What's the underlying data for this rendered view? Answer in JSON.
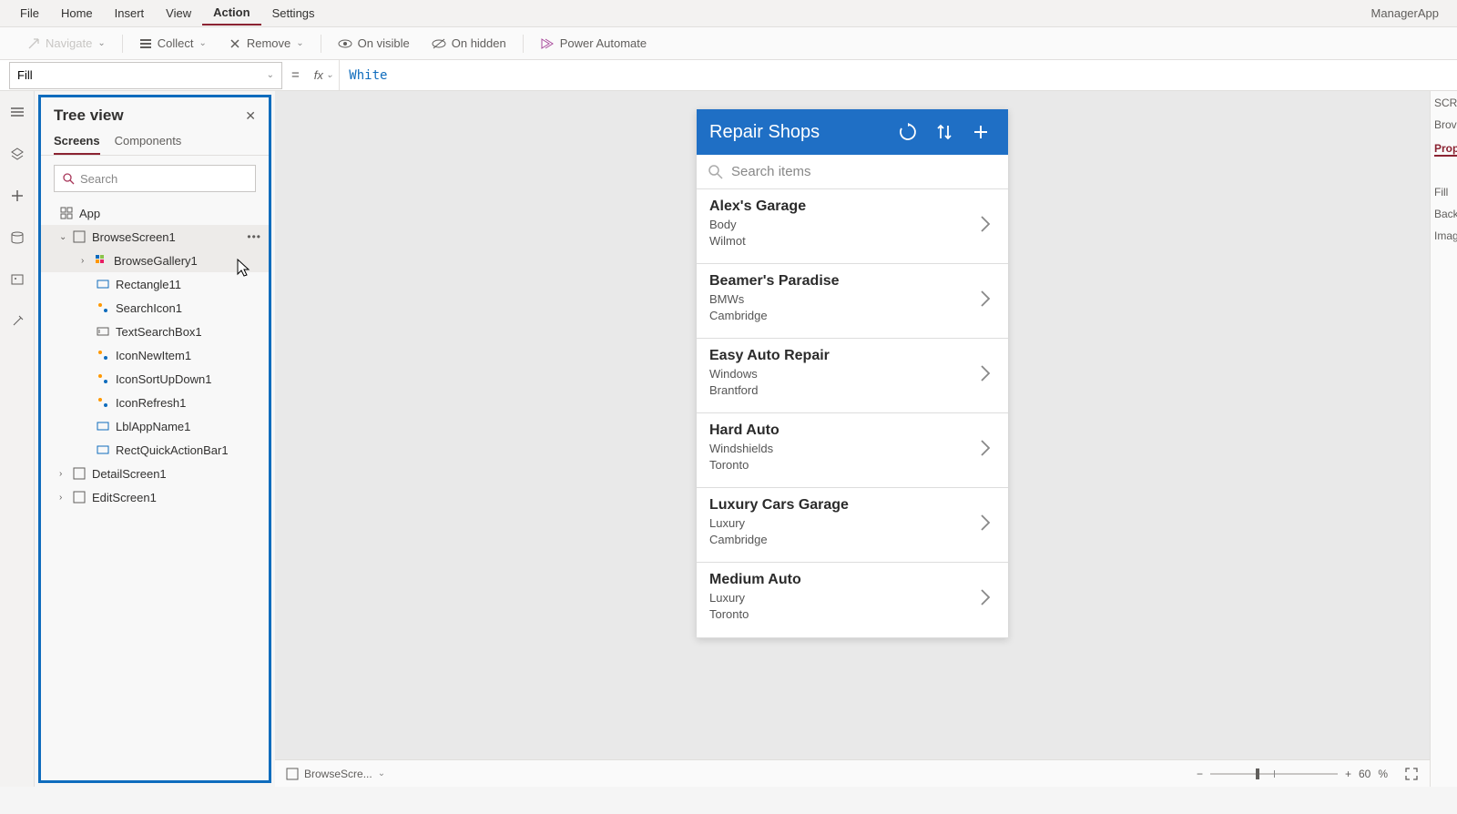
{
  "app_name": "ManagerApp",
  "menubar": {
    "items": [
      "File",
      "Home",
      "Insert",
      "View",
      "Action",
      "Settings"
    ],
    "active_index": 4
  },
  "ribbon": {
    "navigate": "Navigate",
    "collect": "Collect",
    "remove": "Remove",
    "onvisible": "On visible",
    "onhidden": "On hidden",
    "powerautomate": "Power Automate"
  },
  "formulabar": {
    "property": "Fill",
    "formula": "White"
  },
  "treeview": {
    "title": "Tree view",
    "tabs": [
      "Screens",
      "Components"
    ],
    "active_tab": 0,
    "search_placeholder": "Search",
    "items": {
      "app": "App",
      "browsescreen": "BrowseScreen1",
      "browsegallery": "BrowseGallery1",
      "rectangle": "Rectangle11",
      "searchicon": "SearchIcon1",
      "textsearchbox": "TextSearchBox1",
      "iconnewitem": "IconNewItem1",
      "iconsortupdown": "IconSortUpDown1",
      "iconrefresh": "IconRefresh1",
      "lblappname": "LblAppName1",
      "rectquickactionbar": "RectQuickActionBar1",
      "detailscreen": "DetailScreen1",
      "editscreen": "EditScreen1"
    }
  },
  "preview": {
    "title": "Repair Shops",
    "search_placeholder": "Search items",
    "rows": [
      {
        "title": "Alex's Garage",
        "sub1": "Body",
        "sub2": "Wilmot"
      },
      {
        "title": "Beamer's Paradise",
        "sub1": "BMWs",
        "sub2": "Cambridge"
      },
      {
        "title": "Easy Auto Repair",
        "sub1": "Windows",
        "sub2": "Brantford"
      },
      {
        "title": "Hard Auto",
        "sub1": "Windshields",
        "sub2": "Toronto"
      },
      {
        "title": "Luxury Cars Garage",
        "sub1": "Luxury",
        "sub2": "Cambridge"
      },
      {
        "title": "Medium Auto",
        "sub1": "Luxury",
        "sub2": "Toronto"
      }
    ]
  },
  "canvasbar": {
    "screen": "BrowseScre...",
    "zoom": "60",
    "zoom_unit": "%"
  },
  "rightpanel": {
    "l1": "SCRE",
    "l2": "Brov",
    "l3": "Prop",
    "l4": "Fill",
    "l5": "Back",
    "l6": "Imag"
  }
}
